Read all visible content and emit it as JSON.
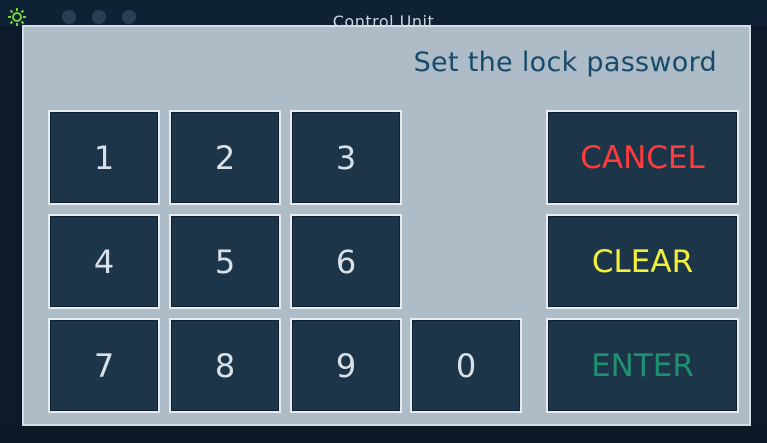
{
  "window": {
    "title": "Control Unit"
  },
  "dialog": {
    "title": "Set the lock password"
  },
  "keypad": {
    "keys": [
      "1",
      "2",
      "3",
      "4",
      "5",
      "6",
      "7",
      "8",
      "9",
      "0"
    ]
  },
  "actions": {
    "cancel_label": "CANCEL",
    "clear_label": "CLEAR",
    "enter_label": "ENTER"
  },
  "icons": {
    "status": "sun-icon"
  },
  "colors": {
    "cancel": "#ff3b3b",
    "clear": "#f2ee3a",
    "enter": "#1f8f70",
    "key_background": "#1c3549",
    "dialog_background": "#aebcc8",
    "title_text": "#174a6c"
  }
}
